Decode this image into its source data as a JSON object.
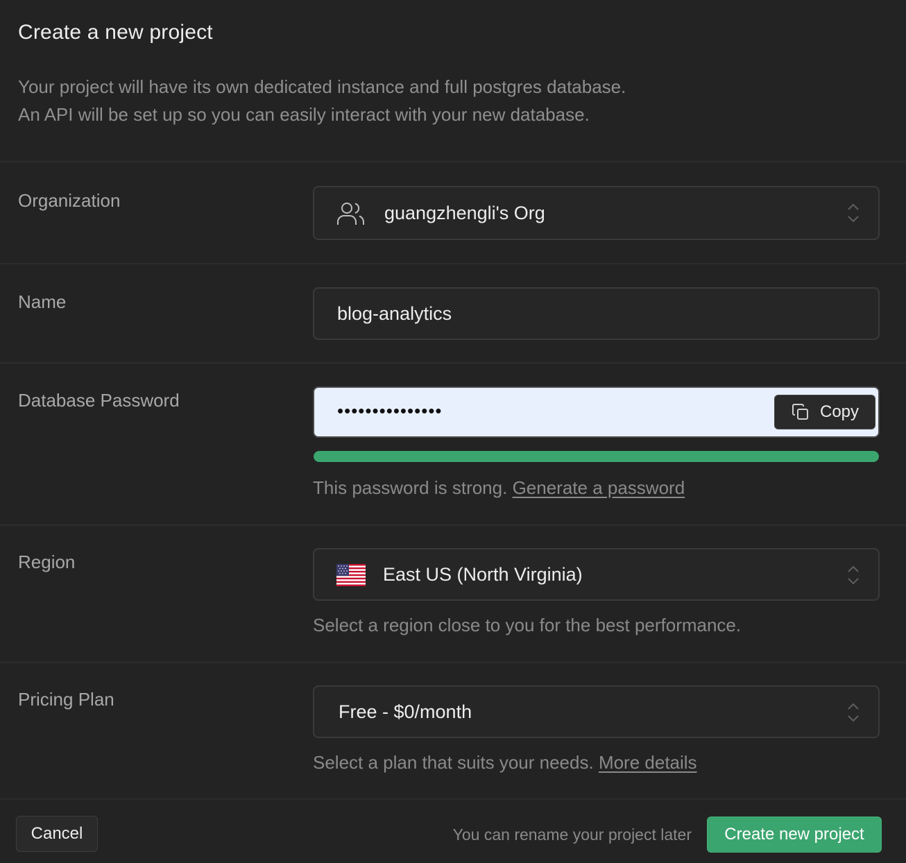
{
  "header": {
    "title": "Create a new project",
    "description_line1": "Your project will have its own dedicated instance and full postgres database.",
    "description_line2": "An API will be set up so you can easily interact with your new database."
  },
  "organization": {
    "label": "Organization",
    "value": "guangzhengli's Org",
    "icon": "users-icon"
  },
  "name": {
    "label": "Name",
    "value": "blog-analytics"
  },
  "password": {
    "label": "Database Password",
    "masked_value": "•••••••••••••••",
    "copy_label": "Copy",
    "strength_fraction": 1.0,
    "strength_color": "#3ba56f",
    "hint": "This password is strong.",
    "generate_link": "Generate a password"
  },
  "region": {
    "label": "Region",
    "value": "East US (North Virginia)",
    "flag": "us-flag-icon",
    "hint": "Select a region close to you for the best performance."
  },
  "pricing": {
    "label": "Pricing Plan",
    "value": "Free - $0/month",
    "hint": "Select a plan that suits your needs.",
    "details_link": "More details"
  },
  "footer": {
    "cancel_label": "Cancel",
    "note": "You can rename your project later",
    "create_label": "Create new project"
  },
  "colors": {
    "background": "#232323",
    "accent": "#3ba56f",
    "autofill": "#e8f0fe"
  }
}
